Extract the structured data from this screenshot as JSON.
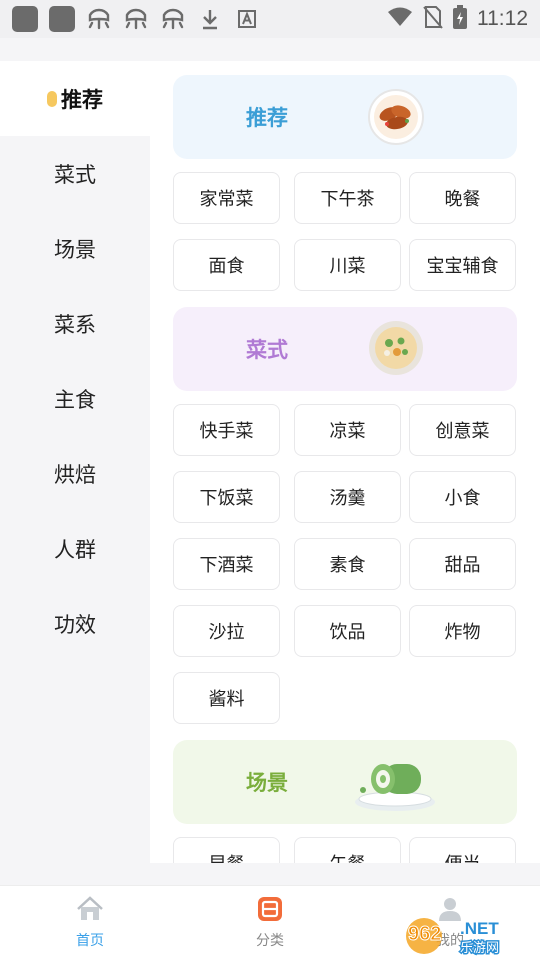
{
  "status_bar": {
    "time": "11:12",
    "icons": [
      "app-icon",
      "app-icon",
      "bug-icon",
      "bug-icon",
      "bug-icon",
      "download-icon",
      "text-a-icon",
      "wifi-icon",
      "no-sim-icon",
      "battery-icon"
    ]
  },
  "sidebar": {
    "items": [
      {
        "label": "推荐",
        "active": true
      },
      {
        "label": "菜式",
        "active": false
      },
      {
        "label": "场景",
        "active": false
      },
      {
        "label": "菜系",
        "active": false
      },
      {
        "label": "主食",
        "active": false
      },
      {
        "label": "烘焙",
        "active": false
      },
      {
        "label": "人群",
        "active": false
      },
      {
        "label": "功效",
        "active": false
      }
    ]
  },
  "sections": [
    {
      "title": "推荐",
      "color": "#3b9ed6",
      "bg": "#eef6fd",
      "tags": [
        "家常菜",
        "下午茶",
        "晚餐",
        "面食",
        "川菜",
        "宝宝辅食"
      ]
    },
    {
      "title": "菜式",
      "color": "#b07ad4",
      "bg": "#f6effb",
      "tags": [
        "快手菜",
        "凉菜",
        "创意菜",
        "下饭菜",
        "汤羹",
        "小食",
        "下酒菜",
        "素食",
        "甜品",
        "沙拉",
        "饮品",
        "炸物",
        "酱料"
      ]
    },
    {
      "title": "场景",
      "color": "#7aae3c",
      "bg": "#f1f8e9",
      "tags": [
        "早餐",
        "午餐",
        "便当"
      ]
    }
  ],
  "bottom_nav": {
    "items": [
      {
        "label": "首页",
        "icon": "home-icon",
        "active": true
      },
      {
        "label": "分类",
        "icon": "category-icon",
        "active": false
      },
      {
        "label": "我的",
        "icon": "user-icon",
        "active": false
      }
    ]
  },
  "watermark": {
    "text_top": "962.NET",
    "text_bottom": "乐游网"
  }
}
